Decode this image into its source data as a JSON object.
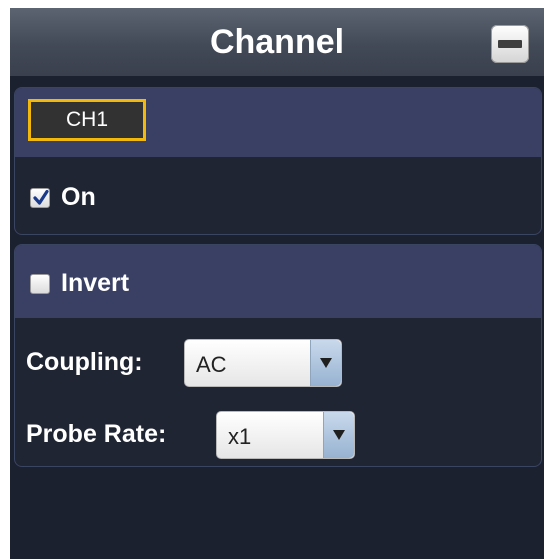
{
  "window": {
    "title": "Channel"
  },
  "channel_panel": {
    "channel_button": "CH1",
    "on_label": "On",
    "on_checked": true
  },
  "settings_panel": {
    "invert_label": "Invert",
    "invert_checked": false,
    "coupling_label": "Coupling:",
    "coupling_value": "AC",
    "probe_rate_label": "Probe Rate:",
    "probe_rate_value": "x1"
  },
  "icons": {
    "minimize": "minimize-icon",
    "checkmark": "checkmark-icon",
    "dropdown_arrow": "chevron-down-icon"
  },
  "colors": {
    "selection_border": "#f2b90c",
    "panel_header": "#3a4064",
    "background": "#1c2130"
  }
}
